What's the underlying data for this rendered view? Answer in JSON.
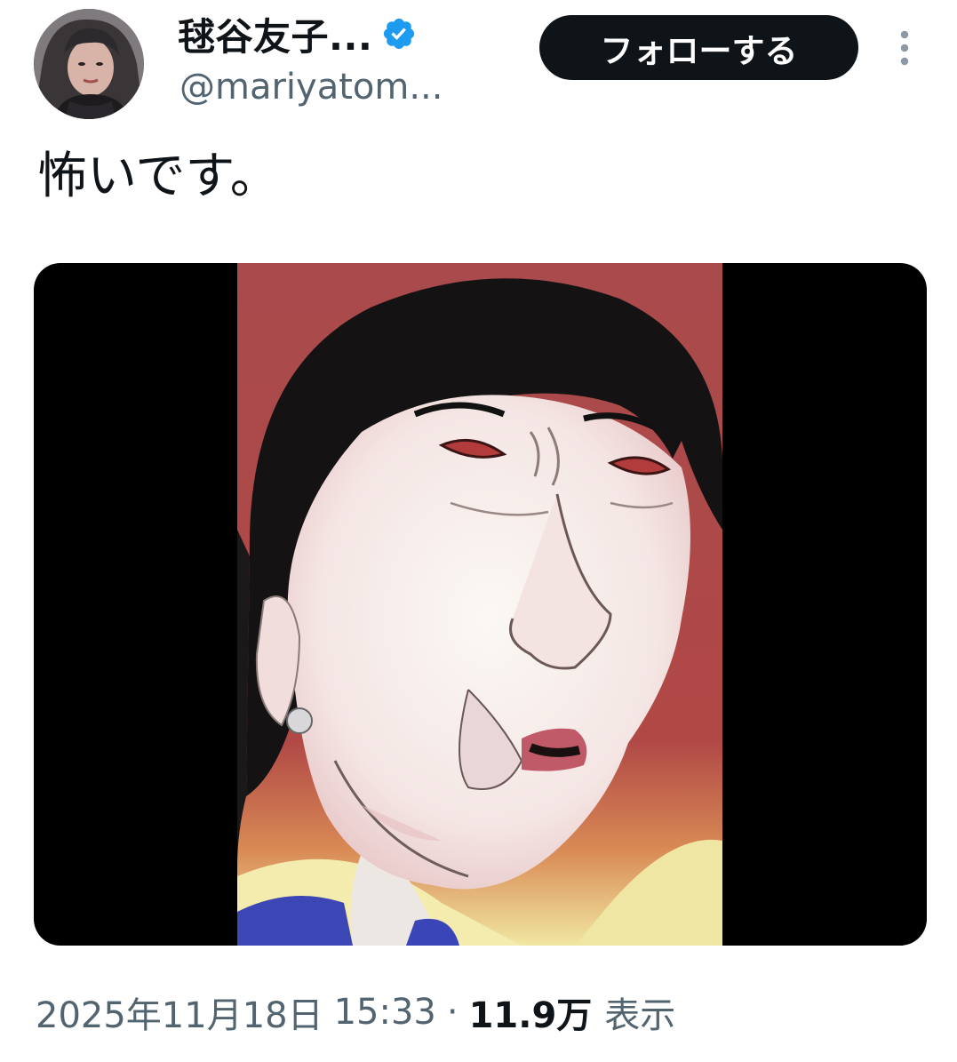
{
  "author": {
    "display_name": "毬谷友子...",
    "handle": "@mariyatom...",
    "verified": true,
    "avatar_icon": "avatar-photo"
  },
  "actions": {
    "follow_label": "フォローする",
    "more_icon": "vertical-ellipsis-icon"
  },
  "tweet": {
    "text": "怖いです。",
    "media_alt": "caricature-painting"
  },
  "meta": {
    "date": "2025年11月18日",
    "time": "15:33",
    "separator": "·",
    "views_count": "11.9万",
    "views_label": "表示"
  },
  "colors": {
    "verified_blue": "#1d9bf0",
    "follow_button_bg": "#0f1419",
    "secondary_text": "#536471",
    "primary_text": "#0f1419",
    "media_bg": "#000000"
  }
}
